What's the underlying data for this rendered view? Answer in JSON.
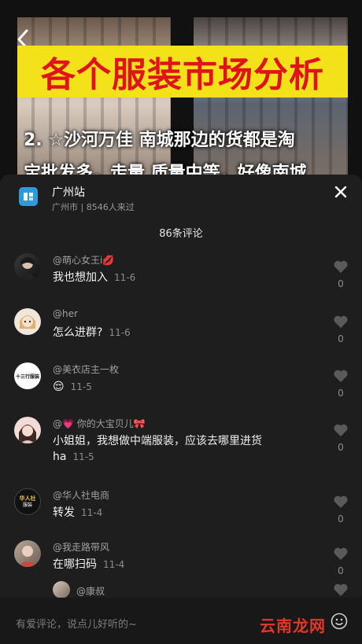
{
  "video": {
    "banner_title": "各个服装市场分析",
    "caption_line1": "2. ☆沙河万佳 南城那边的货都是淘",
    "caption_line2": "宝批发多，走量 质量中等，好像南城"
  },
  "sheet": {
    "poi_name": "广州站",
    "poi_meta": "广州市 | 8546人来过",
    "comment_count": "86条评论"
  },
  "comments": [
    {
      "user": "@萌心女王i💋",
      "text": "我也想加入",
      "time": "11-6",
      "likes": "0"
    },
    {
      "user": "@her",
      "text": "怎么进群?",
      "time": "11-6",
      "likes": "0"
    },
    {
      "user": "@美衣店主一枚",
      "text": "😌",
      "time": "11-5",
      "likes": "0"
    },
    {
      "user": "@💗 你的大宝贝儿🎀",
      "text": "小姐姐，我想做中端服装，应该去哪里进货",
      "text2": "ha",
      "time": "11-5",
      "likes": "0"
    },
    {
      "user": "@华人社电商",
      "text": "转发",
      "time": "11-4",
      "likes": "0"
    },
    {
      "user": "@我走路带风",
      "text": "在哪扫码",
      "time": "11-4",
      "likes": "0"
    },
    {
      "user": "@康叔"
    }
  ],
  "avatar_labels": {
    "shop": "十三行服装",
    "huaren_top": "华人社",
    "huaren_mid": "服装"
  },
  "input": {
    "placeholder": "有爱评论，说点儿好听的~"
  },
  "watermark": "云南龙网",
  "colors": {
    "banner_bg": "#f3e21a",
    "banner_text": "#e0121a",
    "sheet_bg": "#1e1e1e",
    "poi_icon": "#2d9bd8",
    "watermark": "#e0382a"
  }
}
